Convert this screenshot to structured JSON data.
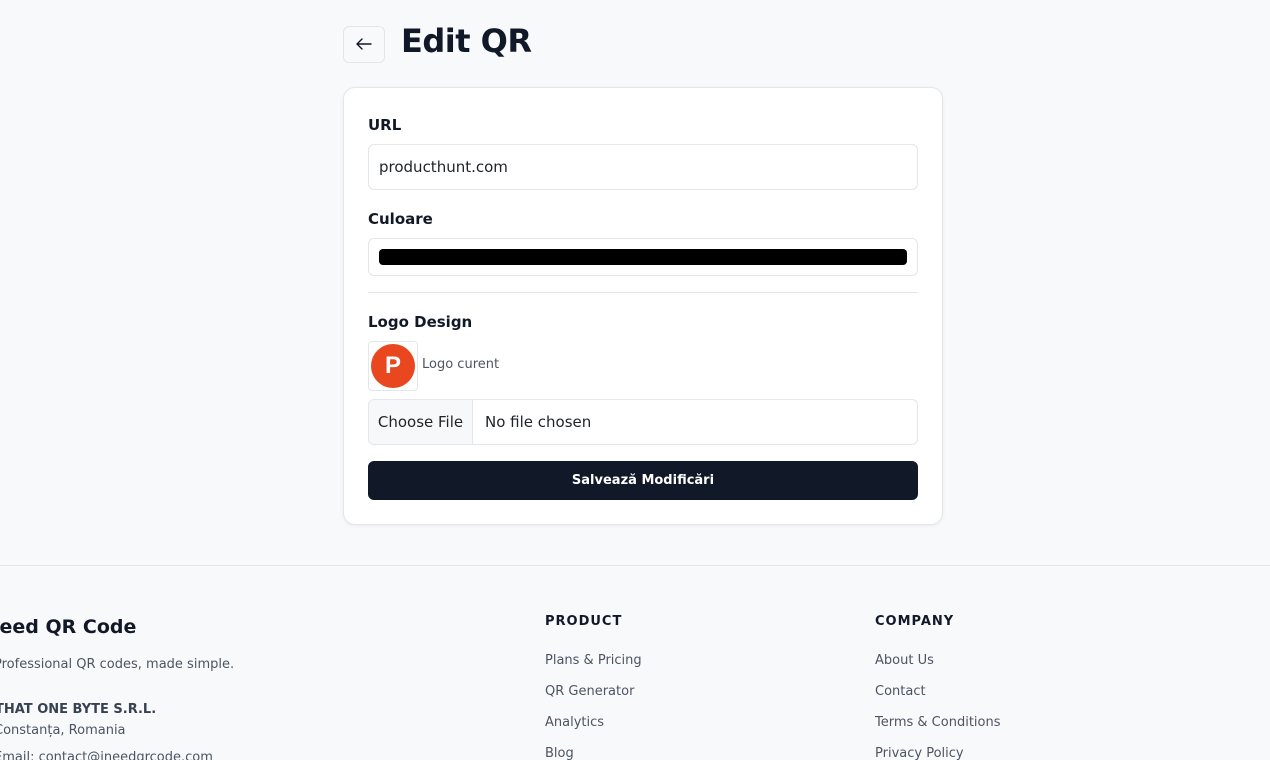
{
  "header": {
    "back_icon": "arrow-left-icon",
    "title": "Edit QR"
  },
  "form": {
    "url_label": "URL",
    "url_value": "producthunt.com",
    "color_label": "Culoare",
    "color_value": "#000000",
    "logo_label": "Logo Design",
    "logo_letter": "P",
    "logo_color": "#e9471f",
    "logo_caption": "Logo curent",
    "file_button": "Choose File",
    "file_status": "No file chosen",
    "save_label": "Salvează Modificări"
  },
  "footer": {
    "brand": "need QR Code",
    "tagline": "Professional QR codes, made simple.",
    "company_name": "THAT ONE BYTE S.R.L.",
    "company_city": "Constanța, Romania",
    "company_email": "Email: contact@ineedqrcode.com",
    "product": {
      "heading": "PRODUCT",
      "links": [
        "Plans & Pricing",
        "QR Generator",
        "Analytics",
        "Blog"
      ]
    },
    "company": {
      "heading": "COMPANY",
      "links": [
        "About Us",
        "Contact",
        "Terms & Conditions",
        "Privacy Policy"
      ]
    }
  }
}
